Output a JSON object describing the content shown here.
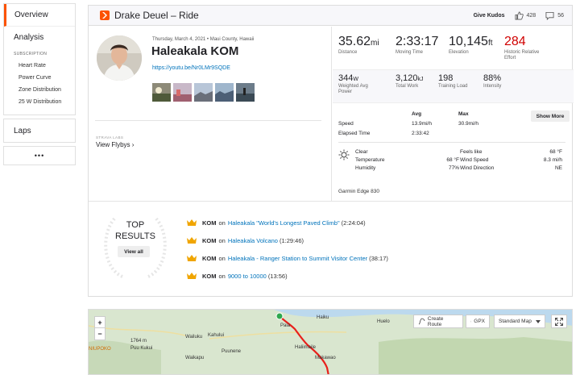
{
  "sidebar": {
    "overview": "Overview",
    "analysis": "Analysis",
    "subscription_heading": "SUBSCRIPTION",
    "items": [
      {
        "label": "Heart Rate"
      },
      {
        "label": "Power Curve"
      },
      {
        "label": "Zone Distribution"
      },
      {
        "label": "25 W Distribution"
      }
    ],
    "laps": "Laps",
    "more": "•••"
  },
  "header": {
    "title": "Drake Deuel – Ride",
    "kudos_label": "Give Kudos",
    "kudos_count": "428",
    "comment_count": "56"
  },
  "activity": {
    "date": "Thursday, March 4, 2021 • Maui County, Hawaii",
    "title": "Haleakala KOM",
    "link": "https://youtu.be/Nr0LMr9SQDE",
    "strava_labs": "STRAVA LABS",
    "flybys": "View Flybys ›"
  },
  "stats": {
    "distance": {
      "value": "35.62",
      "unit": "mi",
      "label": "Distance"
    },
    "moving_time": {
      "value": "2:33:17",
      "label": "Moving Time"
    },
    "elevation": {
      "value": "10,145",
      "unit": "ft",
      "label": "Elevation"
    },
    "relative_effort": {
      "value": "284",
      "label": "Historic Relative Effort"
    },
    "weighted_power": {
      "value": "344",
      "unit": "W",
      "label": "Weighted Avg Power"
    },
    "total_work": {
      "value": "3,120",
      "unit": "kJ",
      "label": "Total Work"
    },
    "training_load": {
      "value": "198",
      "label": "Training Load"
    },
    "intensity": {
      "value": "88%",
      "label": "Intensity"
    }
  },
  "table": {
    "avg_header": "Avg",
    "max_header": "Max",
    "show_more": "Show More",
    "speed_label": "Speed",
    "speed_avg": "13.9mi/h",
    "speed_max": "30.9mi/h",
    "elapsed_label": "Elapsed Time",
    "elapsed_value": "2:33:42"
  },
  "weather": {
    "condition": "Clear",
    "temp_label": "Temperature",
    "temp_value": "68 °F",
    "humidity_label": "Humidity",
    "humidity_value": "77%",
    "feels_label": "Feels like",
    "feels_value": "68 °F",
    "wind_speed_label": "Wind Speed",
    "wind_speed_value": "8.3 mi/h",
    "wind_dir_label": "Wind Direction",
    "wind_dir_value": "NE"
  },
  "device": "Garmin Edge 830",
  "top_results": {
    "line1": "TOP",
    "line2": "RESULTS",
    "view_all": "View all",
    "items": [
      {
        "badge": "KOM",
        "on": "on",
        "segment": "Haleakala \"World's Longest Paved Climb\"",
        "time": "(2:24:04)"
      },
      {
        "badge": "KOM",
        "on": "on",
        "segment": "Haleakala Volcano",
        "time": "(1:29:46)"
      },
      {
        "badge": "KOM",
        "on": "on",
        "segment": "Haleakala - Ranger Station to Summit Visitor Center",
        "time": "(38:17)"
      },
      {
        "badge": "KOM",
        "on": "on",
        "segment": "9000 to 10000",
        "time": "(13:56)"
      }
    ]
  },
  "map": {
    "zoom_in": "+",
    "zoom_out": "−",
    "create_route": "Create Route",
    "gpx": "GPX",
    "map_type": "Standard Map",
    "labels": [
      "Haiku",
      "Huelo",
      "Paia",
      "Wailuku",
      "Kahului",
      "Haliimaile",
      "Puunene",
      "Makawao",
      "Waikapu",
      "1764 m",
      "Puu Kukui",
      "NIUPOKO"
    ]
  },
  "colors": {
    "brand": "#fc5200",
    "link": "#0073bb",
    "effort": "#d00000",
    "route": "#e8201b",
    "crown": "#f0a500"
  }
}
